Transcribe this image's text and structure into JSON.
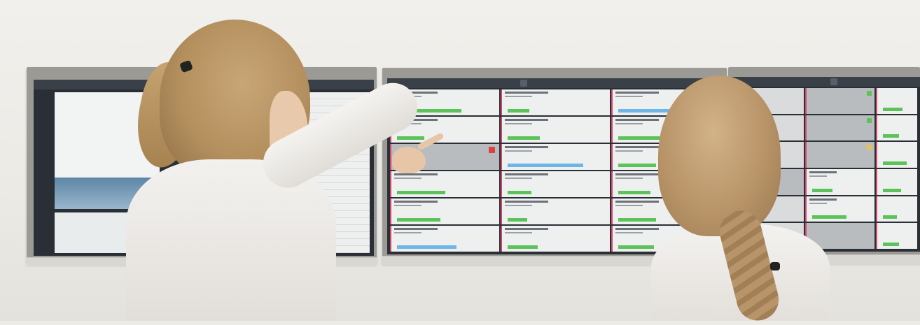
{
  "scene": {
    "description_icons": [
      "screen-left",
      "screen-center",
      "screen-right"
    ]
  },
  "screens": {
    "left": {
      "title": "",
      "time": ""
    },
    "center": {
      "title": "",
      "time": ""
    },
    "right": {
      "title": "",
      "time": ""
    }
  },
  "colors": {
    "wall": "#ecebe6",
    "screen": "#2a2f36",
    "card": "#eef0f0",
    "accent_pink": "#d04a6a",
    "accent_green": "#5cc25a",
    "accent_blue": "#6fb6e8",
    "accent_red": "#e04040",
    "accent_yellow": "#e8c24a"
  }
}
